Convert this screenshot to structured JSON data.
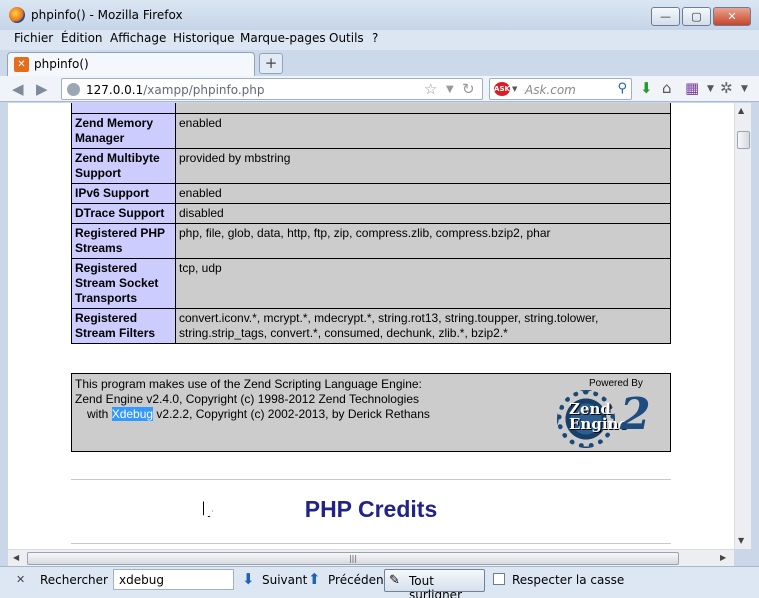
{
  "window": {
    "title": "phpinfo() - Mozilla Firefox"
  },
  "menu": [
    "Fichier",
    "Édition",
    "Affichage",
    "Historique",
    "Marque-pages",
    "Outils",
    "?"
  ],
  "tab": {
    "label": "phpinfo()"
  },
  "url": {
    "host": "127.0.0.1",
    "path": "/xampp/phpinfo.php"
  },
  "search": {
    "placeholder": "Ask.com",
    "engine_icon": "ASK"
  },
  "table": {
    "rows": [
      {
        "key": "Zend Memory Manager",
        "value": "enabled"
      },
      {
        "key": "Zend Multibyte Support",
        "value": "provided by mbstring"
      },
      {
        "key": "IPv6 Support",
        "value": "enabled"
      },
      {
        "key": "DTrace Support",
        "value": "disabled"
      },
      {
        "key": "Registered PHP Streams",
        "value": "php, file, glob, data, http, ftp, zip, compress.zlib, compress.bzip2, phar"
      },
      {
        "key": "Registered Stream Socket Transports",
        "value": "tcp, udp"
      },
      {
        "key": "Registered Stream Filters",
        "value": "convert.iconv.*, mcrypt.*, mdecrypt.*, string.rot13, string.toupper, string.tolower, string.strip_tags, convert.*, consumed, dechunk, zlib.*, bzip2.*"
      }
    ]
  },
  "zend": {
    "line1": "This program makes use of the Zend Scripting Language Engine:",
    "line2": "Zend Engine v2.4.0, Copyright (c) 1998-2012 Zend Technologies",
    "line3_pre": "with ",
    "line3_highlight": "Xdebug",
    "line3_post": " v2.2.2, Copyright (c) 2002-2013, by Derick Rethans",
    "powered_by": "Powered By",
    "logo_word1": "Zend",
    "logo_word2": "Engine",
    "logo_number": "2"
  },
  "credits_heading": "PHP Credits",
  "findbar": {
    "close": "✕",
    "label": "Rechercher :",
    "query": "xdebug",
    "next": "Suivant",
    "previous": "Précédent",
    "highlight_all": "Tout surligner",
    "match_case": "Respecter la casse",
    "match_case_checked": false
  },
  "window_buttons": {
    "minimize": "—",
    "maximize": "▢",
    "close": "✕"
  }
}
